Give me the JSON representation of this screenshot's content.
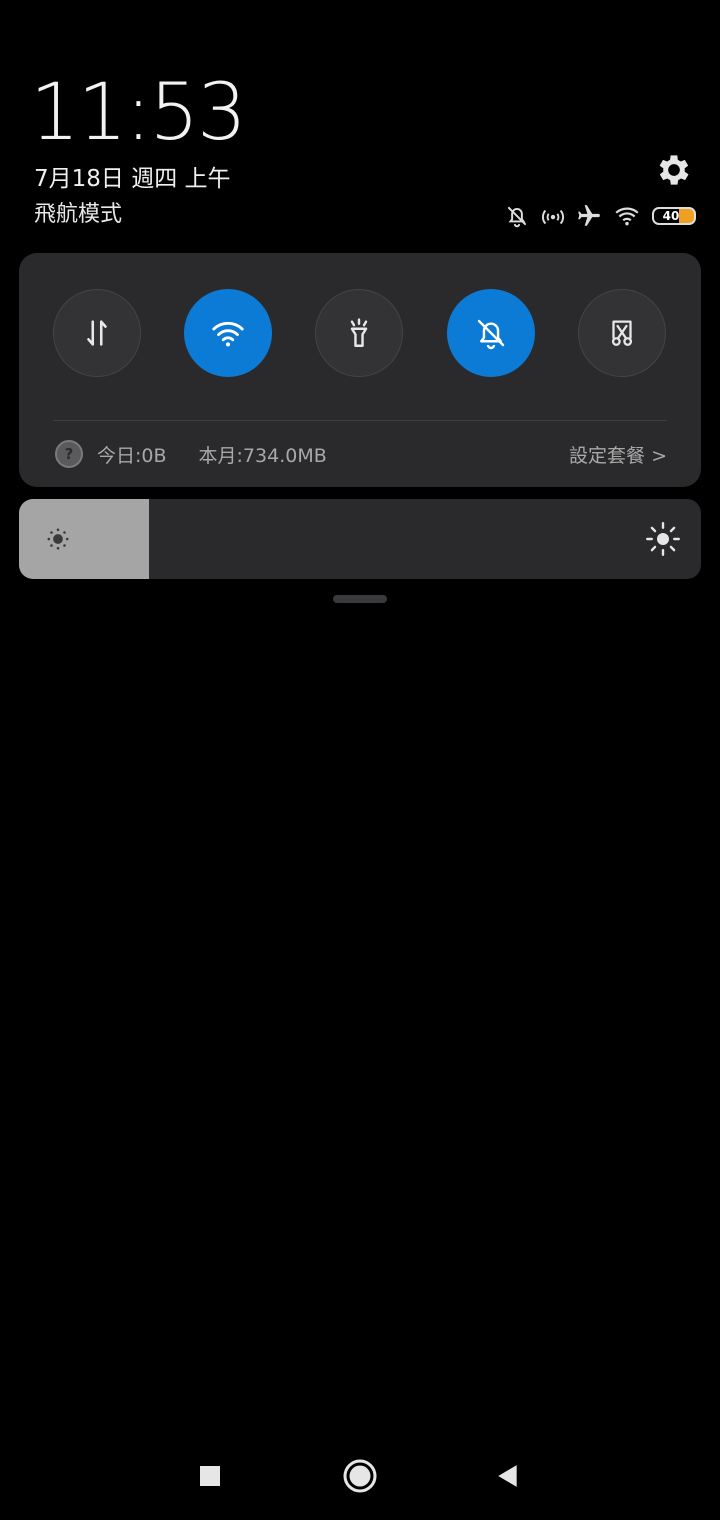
{
  "status": {
    "time": "11:53",
    "date": "7月18日 週四 上午",
    "carrier": "飛航模式",
    "battery_level": "40",
    "icons": [
      "bell-off-icon",
      "hotspot-icon",
      "airplane-icon",
      "wifi-icon",
      "battery-icon"
    ]
  },
  "quick_settings": {
    "toggles": [
      {
        "name": "mobile-data",
        "icon": "data-arrows-icon",
        "state": "off"
      },
      {
        "name": "wifi",
        "icon": "wifi-icon",
        "state": "on"
      },
      {
        "name": "flashlight",
        "icon": "flashlight-icon",
        "state": "off"
      },
      {
        "name": "silent",
        "icon": "bell-off-icon",
        "state": "on"
      },
      {
        "name": "screenshot",
        "icon": "scissors-icon",
        "state": "off"
      }
    ],
    "usage": {
      "help": "?",
      "today": "今日:0B",
      "month": "本月:734.0MB",
      "plan_link": "設定套餐 >"
    }
  },
  "brightness": {
    "level": 0.19
  },
  "colors": {
    "accent": "#0c7bd6",
    "panel": "#2a2a2c",
    "toggle_off": "#333336",
    "battery": "#f0a020"
  },
  "nav": [
    "recents-button",
    "home-button",
    "back-button"
  ]
}
